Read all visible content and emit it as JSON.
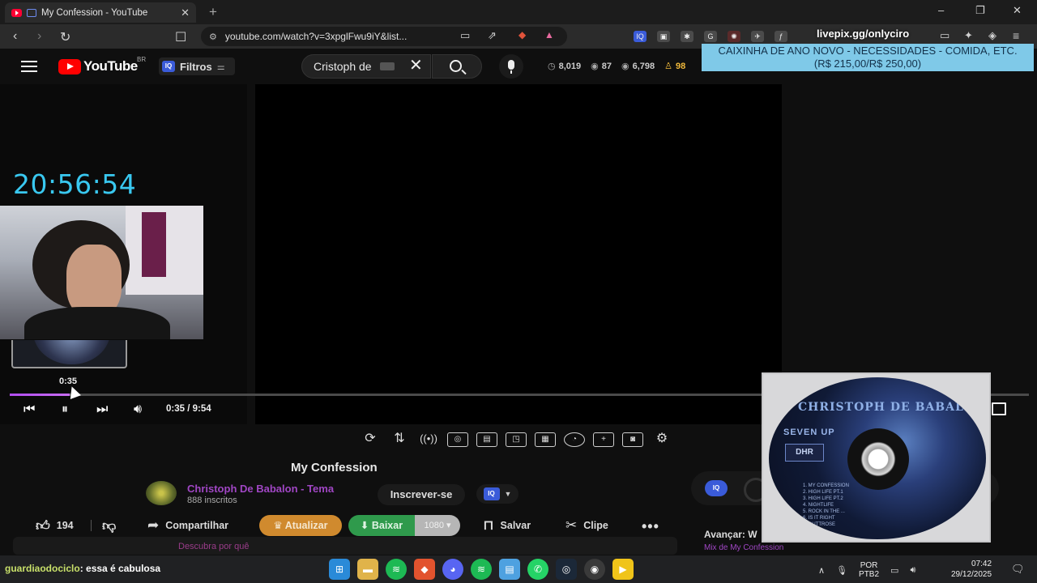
{
  "browser": {
    "tab_title": "My Confession - YouTube",
    "url": "youtube.com/watch?v=3xpglFwu9iY&list...",
    "window_controls": [
      "–",
      "❐",
      "✕"
    ]
  },
  "masthead": {
    "logo_text": "YouTube",
    "country": "BR",
    "filter_label": "Filtros",
    "iq_badge": "IQ",
    "search_value": "Cristoph de",
    "stats": [
      {
        "icon": "clock-icon",
        "value": "8,019"
      },
      {
        "icon": "eye-icon",
        "value": "87"
      },
      {
        "icon": "eye-icon",
        "value": "6,798"
      },
      {
        "icon": "user-icon",
        "value": "98"
      }
    ]
  },
  "overlay": {
    "livepix": "livepix.gg/onlyciro",
    "donation_line1": "CAIXINHA DE ANO NOVO - NECESSIDADES - COMIDA, ETC.",
    "donation_line2": "(R$ 215,00/R$ 250,00)",
    "stream_clock": "20:56:54"
  },
  "player": {
    "hover_time": "0:35",
    "time_display": "0:35 / 9:54",
    "progress": 0.059
  },
  "video": {
    "title": "My Confession",
    "channel": "Christoph De Babalon - Tema",
    "subscribers": "888 inscritos",
    "subscribe_label": "Inscrever-se",
    "likes": "194",
    "share_label": "Compartilhar",
    "update_label": "Atualizar",
    "download_label": "Baixar",
    "quality": "1080",
    "save_label": "Salvar",
    "clip_label": "Clipe",
    "discover_text": "Descubra por quê"
  },
  "sidebar": {
    "next_label": "Avançar: W",
    "mix_label": "Mix de My Confession"
  },
  "album_art": {
    "artist": "CHRISTOPH DE BABALON",
    "album": "SEVEN UP",
    "label": "DHR",
    "tracks": [
      "1. MY CONFESSION",
      "2. HIGH LIFE PT.1",
      "3. HIGH LIFE PT.2",
      "4. NIGHTLIFE",
      "5. ROCK IN THE ...",
      "6. IS IT RIGHT",
      "7. OUTTROSE"
    ]
  },
  "taskbar": {
    "chat_user": "guardiaodociclo",
    "chat_message": ": essa é cabulosa",
    "lang_top": "POR",
    "lang_bottom": "PTB2",
    "time": "07:42",
    "date": "29/12/2025"
  },
  "colors": {
    "accent_purple": "#a046c4",
    "clock_cyan": "#39c8f0",
    "donation_bg": "#7fc9e8",
    "update_orange": "#d08a2e",
    "download_green": "#2f9a4c"
  }
}
